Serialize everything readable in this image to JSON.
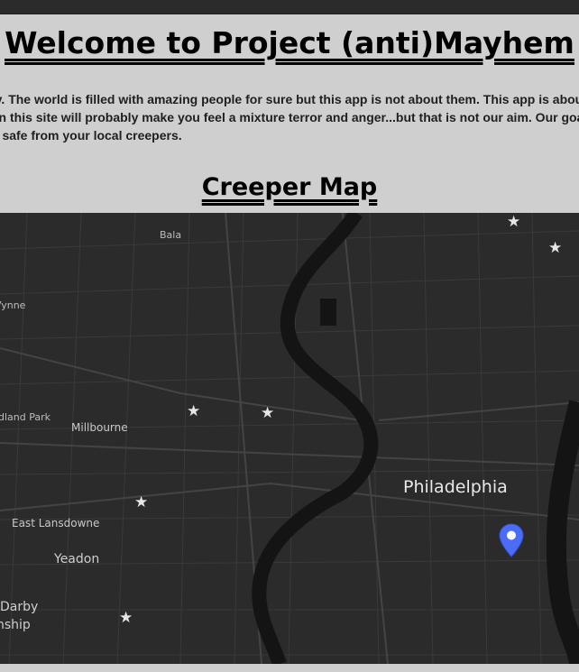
{
  "page": {
    "title": "Welcome to Project (anti)Mayhem",
    "intro_line1": "ty. The world is filled with amazing people for sure but this app is not about them. This app is about the",
    "intro_line2": "on this site will probably make you feel a mixture terror and anger...but that is not our aim. Our goal is t",
    "intro_line3": "u safe from your local creepers.",
    "map_heading": "Creeper Map"
  },
  "map": {
    "labels": {
      "bala": "Bala",
      "wynne": "Vynne",
      "land_park": "dland Park",
      "millbourne": "Millbourne",
      "philadelphia": "Philadelphia",
      "east_lansdowne": "East Lansdowne",
      "yeadon": "Yeadon",
      "darby": "Darby",
      "nship": "nship"
    },
    "marker_icon": "star-icon",
    "pin_icon": "location-pin-icon",
    "pin_color": "#4a6cf7",
    "background_color": "#2b2b2b"
  }
}
